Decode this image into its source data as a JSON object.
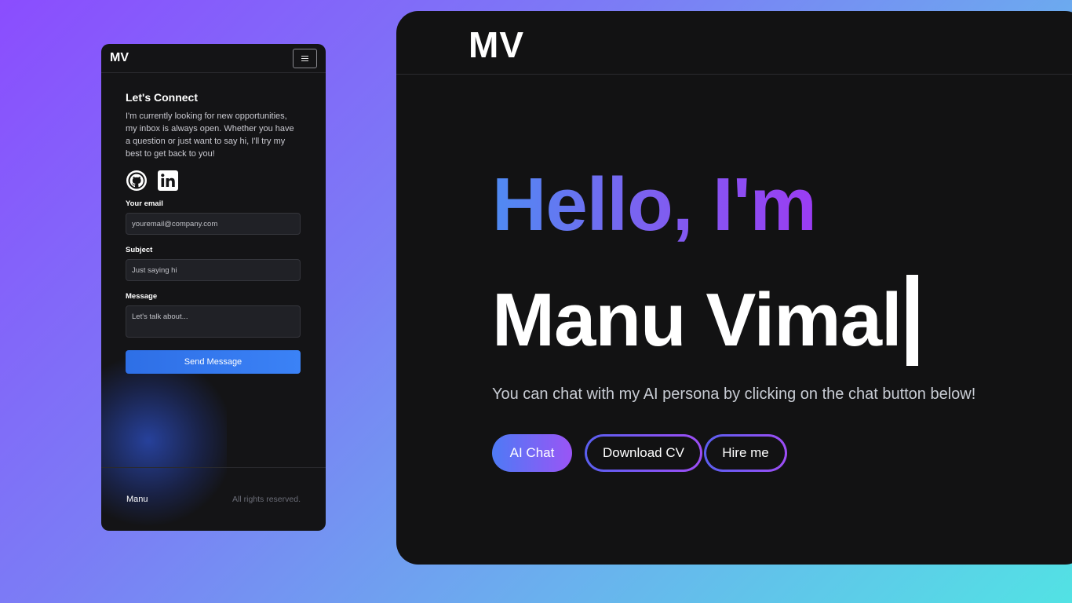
{
  "mobile": {
    "logo": "MV",
    "menu_icon": "hamburger-menu-icon",
    "contact": {
      "title": "Let's Connect",
      "intro": "I'm currently looking for new opportunities, my inbox is always open. Whether you have a question or just want to say hi, I'll try my best to get back to you!",
      "social_icons": [
        "github-icon",
        "linkedin-icon"
      ],
      "email_label": "Your email",
      "email_placeholder": "youremail@company.com",
      "subject_label": "Subject",
      "subject_placeholder": "Just saying hi",
      "message_label": "Message",
      "message_placeholder": "Let's talk about...",
      "send_label": "Send Message"
    },
    "footer": {
      "brand": "Manu",
      "rights": "All rights reserved."
    }
  },
  "desktop": {
    "logo": "MV",
    "greeting": "Hello, I'm",
    "name": "Manu Vimal",
    "tagline": "You can chat with my AI persona by clicking on the chat button below!",
    "buttons": {
      "ai_chat": "AI Chat",
      "download_cv": "Download CV",
      "hire_me": "Hire me"
    }
  },
  "colors": {
    "accent_blue": "#3b82f6",
    "accent_purple": "#9b3cf3",
    "panel_bg": "#121213"
  }
}
